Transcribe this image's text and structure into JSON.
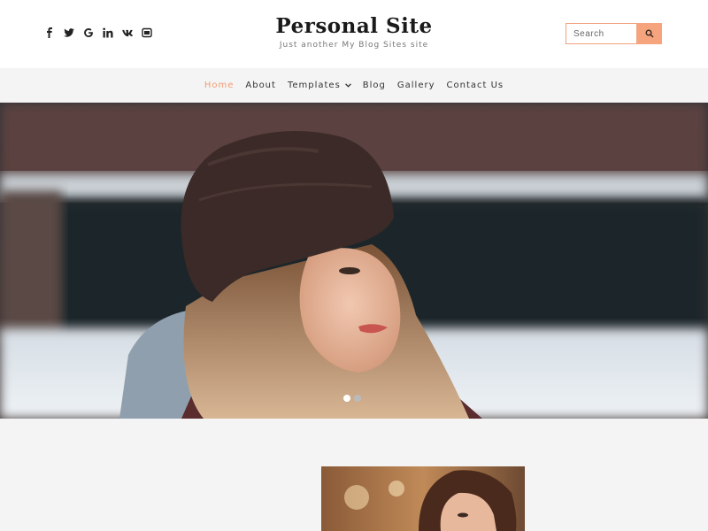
{
  "header": {
    "title": "Personal Site",
    "tagline": "Just another My Blog Sites site",
    "socials": [
      "facebook-icon",
      "twitter-icon",
      "google-icon",
      "linkedin-icon",
      "vk-icon",
      "vimeo-icon"
    ],
    "search": {
      "placeholder": "Search"
    }
  },
  "nav": {
    "items": [
      {
        "label": "Home",
        "active": true
      },
      {
        "label": "About"
      },
      {
        "label": "Templates",
        "has_dropdown": true
      },
      {
        "label": "Blog"
      },
      {
        "label": "Gallery"
      },
      {
        "label": "Contact Us"
      }
    ]
  },
  "hero": {
    "slides": 2,
    "active_slide": 1
  },
  "colors": {
    "accent": "#f39b74",
    "search_button": "#f5a47d",
    "background": "#f4f4f4"
  }
}
